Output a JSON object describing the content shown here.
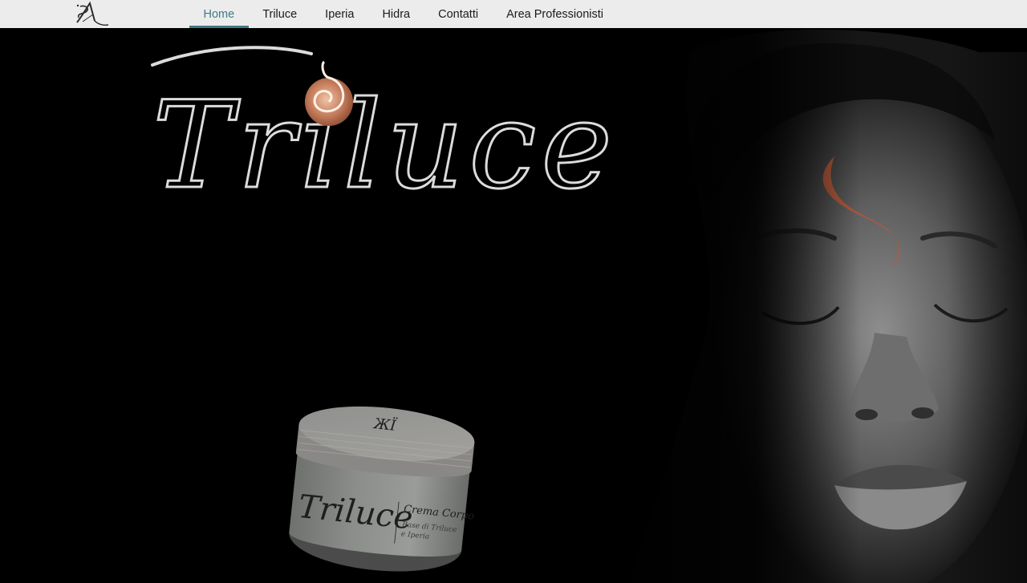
{
  "site": {
    "logo_icon": "sa-monogram-icon"
  },
  "nav": {
    "items": [
      {
        "label": "Home",
        "active": true
      },
      {
        "label": "Triluce",
        "active": false
      },
      {
        "label": "Iperia",
        "active": false
      },
      {
        "label": "Hidra",
        "active": false
      },
      {
        "label": "Contatti",
        "active": false
      },
      {
        "label": "Area Professionisti",
        "active": false
      }
    ]
  },
  "hero": {
    "brand_wordmark": "Triluce",
    "swirl_icon": "copper-swirl-icon",
    "product": {
      "brand": "Triluce",
      "name": "Crema Corpo",
      "subtitle_line1": "Base di Triluce",
      "subtitle_line2": "e Iperia"
    }
  },
  "colors": {
    "accent": "#3f7b86",
    "nav_bg": "#ececec",
    "hero_bg": "#000000",
    "copper": "#b76a4e",
    "wordmark": "#dcdcdc"
  }
}
